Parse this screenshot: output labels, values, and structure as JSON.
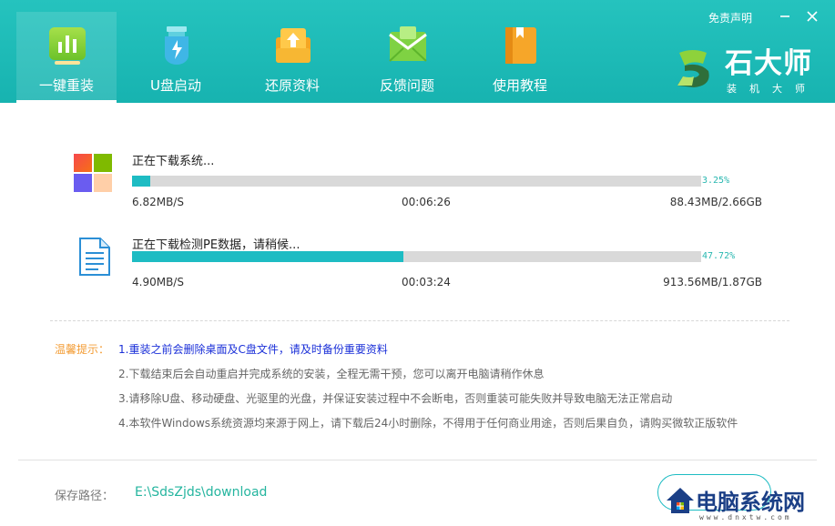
{
  "header": {
    "tabs": [
      {
        "label": "一键重装",
        "icon": "chart-icon",
        "active": true
      },
      {
        "label": "U盘启动",
        "icon": "usb-icon",
        "active": false
      },
      {
        "label": "还原资料",
        "icon": "restore-icon",
        "active": false
      },
      {
        "label": "反馈问题",
        "icon": "mail-icon",
        "active": false
      },
      {
        "label": "使用教程",
        "icon": "book-icon",
        "active": false
      }
    ],
    "disclaimer": "免责声明",
    "minimize_icon": "minimize-icon",
    "close_icon": "close-icon",
    "logo_title": "石大师",
    "logo_subtitle": "装机大师"
  },
  "downloads": [
    {
      "title": "正在下载系统...",
      "icon": "windows-icon",
      "progress_text": "3.25%",
      "progress": 0.0325,
      "speed": "6.82MB/S",
      "time": "00:06:26",
      "size": "88.43MB/2.66GB"
    },
    {
      "title": "正在下载检测PE数据，请稍候...",
      "icon": "document-icon",
      "progress_text": "47.72%",
      "progress": 0.4772,
      "speed": "4.90MB/S",
      "time": "00:03:24",
      "size": "913.56MB/1.87GB"
    }
  ],
  "tips": {
    "label": "温馨提示：",
    "items": [
      "1.重装之前会删除桌面及C盘文件，请及时备份重要资料",
      "2.下载结束后会自动重启并完成系统的安装，全程无需干预，您可以离开电脑请稍作休息",
      "3.请移除U盘、移动硬盘、光驱里的光盘，并保证安装过程中不会断电，否则重装可能失败并导致电脑无法正常启动",
      "4.本软件Windows系统资源均来源于网上，请下载后24小时删除，不得用于任何商业用途，否则后果自负，请购买微软正版软件"
    ]
  },
  "footer": {
    "path_label": "保存路径：",
    "path_value": "E:\\SdsZjds\\download"
  },
  "watermark": {
    "text": "电脑系统网",
    "url": "www.dnxtw.com"
  },
  "colors": {
    "header": "#1fbab6",
    "progress": "#1ebcc3",
    "tip_highlight": "#1a2fd8",
    "tip_label": "#f39c34"
  }
}
